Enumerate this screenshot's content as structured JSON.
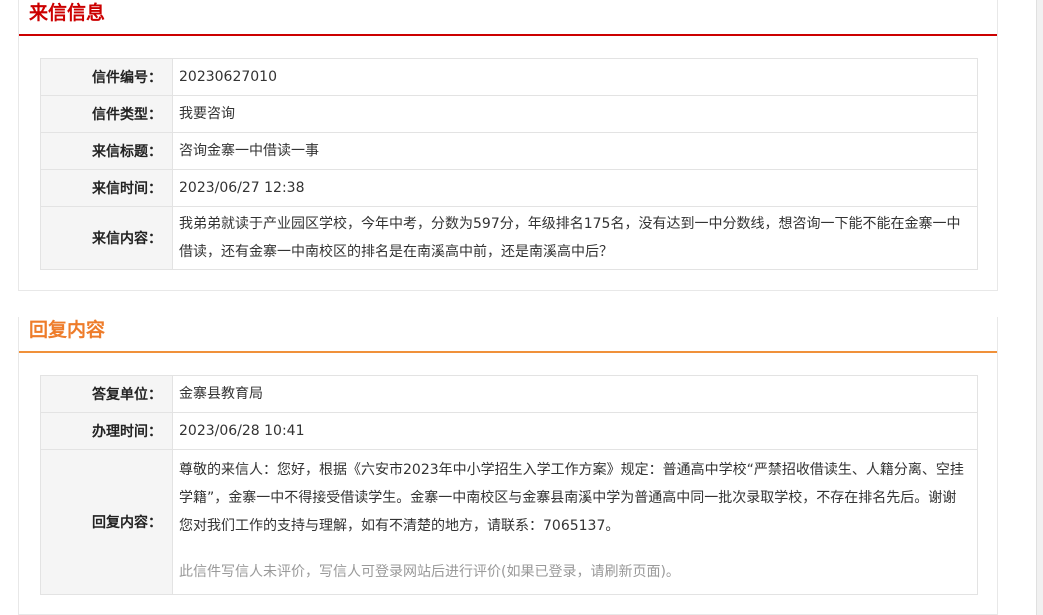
{
  "letter": {
    "section_title": "来信信息",
    "rows": [
      {
        "label": "信件编号：",
        "value": "20230627010"
      },
      {
        "label": "信件类型：",
        "value": "我要咨询"
      },
      {
        "label": "来信标题：",
        "value": "咨询金寨一中借读一事"
      },
      {
        "label": "来信时间：",
        "value": "2023/06/27 12:38"
      },
      {
        "label": "来信内容：",
        "value": "我弟弟就读于产业园区学校，今年中考，分数为597分，年级排名175名，没有达到一中分数线，想咨询一下能不能在金寨一中借读，还有金寨一中南校区的排名是在南溪高中前，还是南溪高中后？"
      }
    ]
  },
  "reply": {
    "section_title": "回复内容",
    "rows": [
      {
        "label": "答复单位：",
        "value": "金寨县教育局"
      },
      {
        "label": "办理时间：",
        "value": "2023/06/28 10:41"
      },
      {
        "label": "回复内容：",
        "value": "尊敬的来信人：您好，根据《六安市2023年中小学招生入学工作方案》规定：普通高中学校“严禁招收借读生、人籍分离、空挂学籍”，金寨一中不得接受借读学生。金寨一中南校区与金寨县南溪中学为普通高中同一批次录取学校，不存在排名先后。谢谢您对我们工作的支持与理解，如有不清楚的地方，请联系：7065137。",
        "note": "此信件写信人未评价，写信人可登录网站后进行评价(如果已登录，请刷新页面)。"
      }
    ]
  },
  "colors": {
    "letter_accent": "#cc0000",
    "reply_accent": "#ee7c2a"
  }
}
